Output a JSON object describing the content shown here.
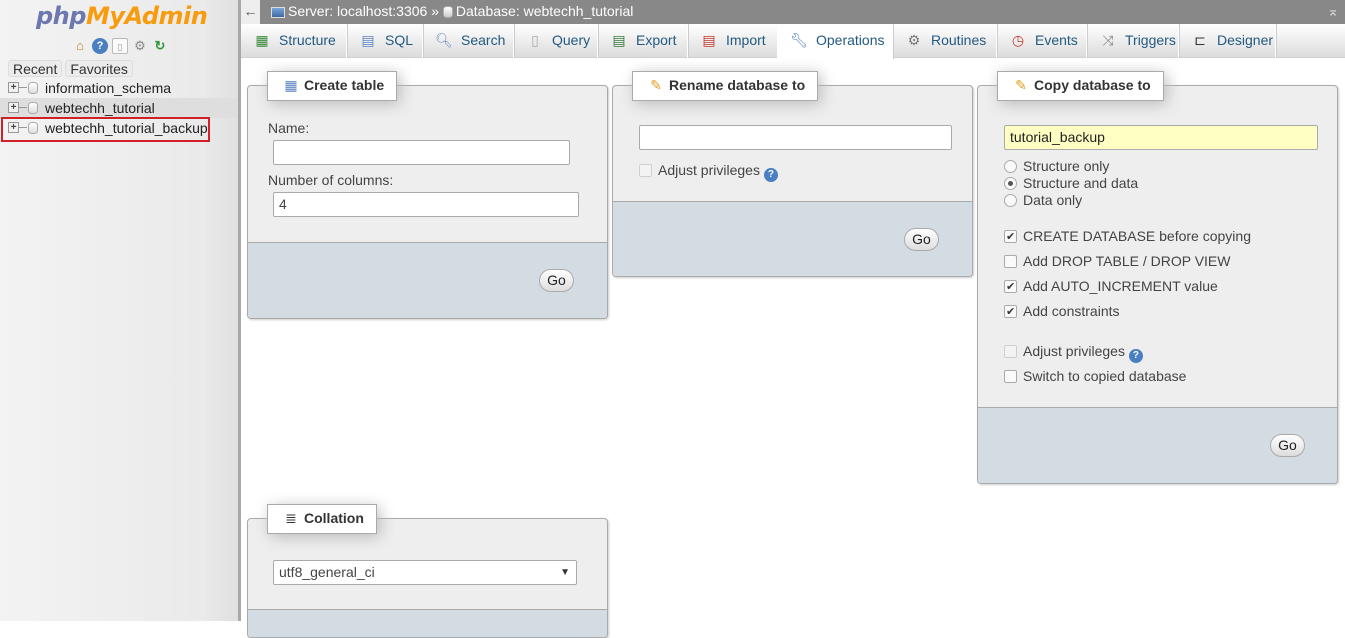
{
  "sidebar": {
    "logo_part1": "php",
    "logo_part2": "MyAdmin",
    "nav_icons": [
      "home-icon",
      "help-icon",
      "docs-icon",
      "settings-icon",
      "reload-icon"
    ],
    "tabs": [
      "Recent",
      "Favorites"
    ],
    "databases": [
      {
        "name": "information_schema",
        "highlighted": false
      },
      {
        "name": "webtechh_tutorial",
        "highlighted": true
      },
      {
        "name": "webtechh_tutorial_backup",
        "highlighted": false,
        "annotated": true
      }
    ],
    "annotation_color": "#d32027"
  },
  "topbar": {
    "back_glyph": "←",
    "server_label": "Server: localhost:3306",
    "separator": "»",
    "database_label": "Database: webtechh_tutorial",
    "collapse_glyph": "⌅"
  },
  "menu": {
    "tabs": [
      {
        "label": "Structure",
        "icon": "structure-icon",
        "active": false
      },
      {
        "label": "SQL",
        "icon": "sql-icon",
        "active": false
      },
      {
        "label": "Search",
        "icon": "search-icon",
        "active": false
      },
      {
        "label": "Query",
        "icon": "query-icon",
        "active": false
      },
      {
        "label": "Export",
        "icon": "export-icon",
        "active": false
      },
      {
        "label": "Import",
        "icon": "import-icon",
        "active": false
      },
      {
        "label": "Operations",
        "icon": "wrench-icon",
        "active": true
      },
      {
        "label": "Routines",
        "icon": "routines-icon",
        "active": false
      },
      {
        "label": "Events",
        "icon": "clock-icon",
        "active": false
      },
      {
        "label": "Triggers",
        "icon": "triggers-icon",
        "active": false
      },
      {
        "label": "Designer",
        "icon": "designer-icon",
        "active": false
      }
    ]
  },
  "create_table": {
    "title": "Create table",
    "name_label": "Name:",
    "name_value": "",
    "columns_label": "Number of columns:",
    "columns_value": "4",
    "go_label": "Go"
  },
  "rename_db": {
    "title": "Rename database to",
    "name_value": "",
    "adjust_privileges_label": "Adjust privileges",
    "adjust_privileges_checked": false,
    "adjust_privileges_disabled": true,
    "go_label": "Go"
  },
  "copy_db": {
    "title": "Copy database to",
    "name_value": "tutorial_backup",
    "radio_options": [
      {
        "label": "Structure only",
        "checked": false
      },
      {
        "label": "Structure and data",
        "checked": true
      },
      {
        "label": "Data only",
        "checked": false
      }
    ],
    "checkbox_options": [
      {
        "label": "CREATE DATABASE before copying",
        "checked": true,
        "disabled": false
      },
      {
        "label": "Add DROP TABLE / DROP VIEW",
        "checked": false,
        "disabled": false
      },
      {
        "label": "Add AUTO_INCREMENT value",
        "checked": true,
        "disabled": false
      },
      {
        "label": "Add constraints",
        "checked": true,
        "disabled": false
      }
    ],
    "adjust_privileges_label": "Adjust privileges",
    "adjust_privileges_checked": false,
    "adjust_privileges_disabled": true,
    "switch_label": "Switch to copied database",
    "switch_checked": false,
    "go_label": "Go"
  },
  "collation": {
    "title": "Collation",
    "selected": "utf8_general_ci"
  }
}
